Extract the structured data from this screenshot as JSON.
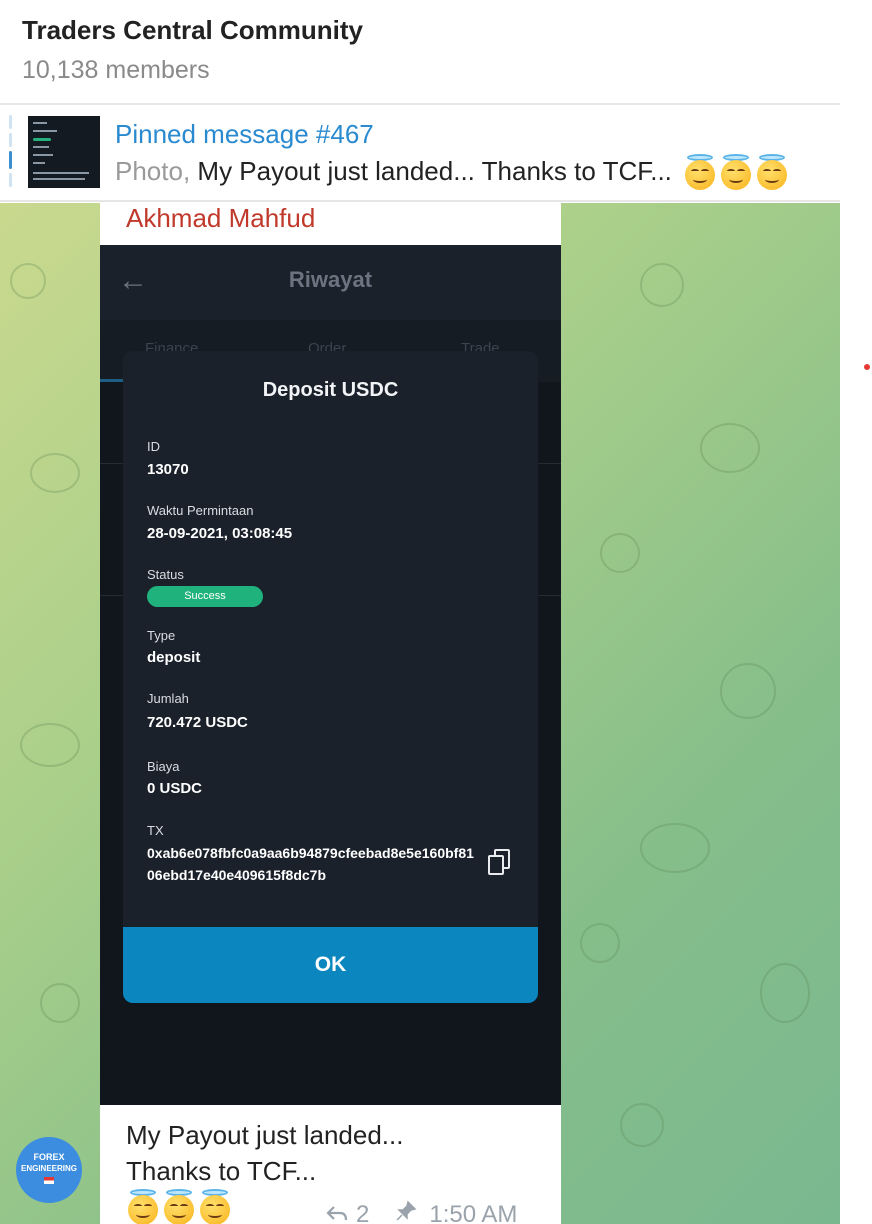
{
  "header": {
    "title": "Traders Central Community",
    "subtitle": "10,138 members"
  },
  "pinned": {
    "title": "Pinned message #467",
    "type_label": "Photo,",
    "preview": "My Payout just landed... Thanks to TCF...",
    "emoji_icon": "smiling-face-with-halo"
  },
  "message": {
    "sender": "Akhmad Mahfud",
    "sender_color": "#c0392b",
    "photo": {
      "app_title": "Riwayat",
      "tabs": [
        "Finance",
        "Order",
        "Trade"
      ],
      "modal": {
        "title": "Deposit USDC",
        "fields": [
          {
            "label": "ID",
            "value": "13070"
          },
          {
            "label": "Waktu Permintaan",
            "value": "28-09-2021, 03:08:45"
          },
          {
            "label": "Status",
            "value": "Success"
          },
          {
            "label": "Type",
            "value": "deposit"
          },
          {
            "label": "Jumlah",
            "value": "720.472 USDC"
          },
          {
            "label": "Biaya",
            "value": "0 USDC"
          },
          {
            "label": "TX",
            "value": "0xab6e078fbfc0a9aa6b94879cfeebad8e5e160bf8106ebd17e40e409615f8dc7b"
          }
        ],
        "ok_label": "OK"
      }
    },
    "caption_line1": "My Payout just landed...",
    "caption_line2": "Thanks to TCF...",
    "replies": "2",
    "time": "1:50 AM"
  },
  "avatar": {
    "line1": "FOREX",
    "line2": "ENGINEERING"
  },
  "colors": {
    "accent": "#2a8ad0",
    "success": "#20b27d",
    "ok_button": "#0b86bf"
  }
}
